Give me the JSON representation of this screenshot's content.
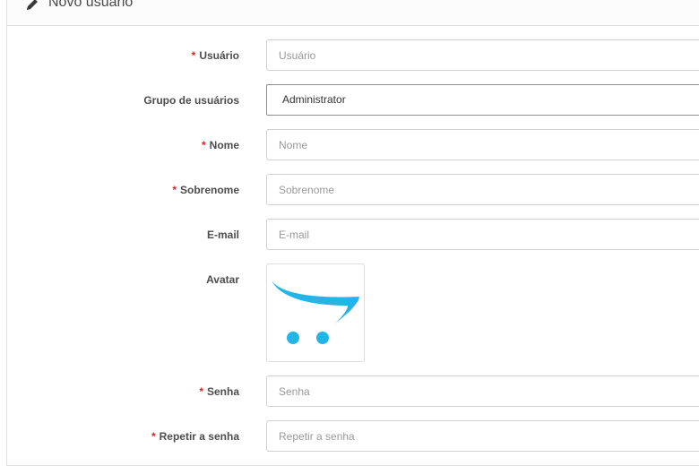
{
  "header": {
    "title": "Novo usuário",
    "icon": "pencil-icon"
  },
  "form": {
    "username": {
      "label": "Usuário",
      "required": true,
      "placeholder": "Usuário",
      "value": ""
    },
    "user_group": {
      "label": "Grupo de usuários",
      "required": false,
      "value": "Administrator"
    },
    "firstname": {
      "label": "Nome",
      "required": true,
      "placeholder": "Nome",
      "value": ""
    },
    "lastname": {
      "label": "Sobrenome",
      "required": true,
      "placeholder": "Sobrenome",
      "value": ""
    },
    "email": {
      "label": "E-mail",
      "required": false,
      "placeholder": "E-mail",
      "value": ""
    },
    "avatar": {
      "label": "Avatar",
      "icon": "opencart-cart-logo"
    },
    "password": {
      "label": "Senha",
      "required": true,
      "placeholder": "Senha",
      "value": ""
    },
    "confirm": {
      "label": "Repetir a senha",
      "required": true,
      "placeholder": "Repetir a senha",
      "value": ""
    }
  },
  "colors": {
    "required_marker": "#dd2222",
    "logo_blue": "#23b5e8"
  },
  "required_marker": "*"
}
